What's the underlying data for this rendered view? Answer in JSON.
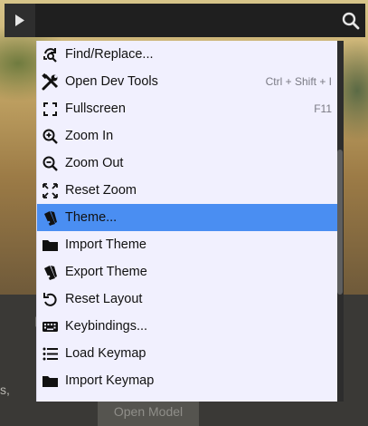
{
  "background": {
    "left_text": "s,",
    "open_model_button": "Open Model"
  },
  "toolbar": {
    "play_icon": "play-icon",
    "search_icon": "search-icon"
  },
  "menu": {
    "selected_color": "#4a8ef2",
    "items": [
      {
        "label": "Find/Replace...",
        "icon": "find-replace-icon",
        "shortcut": ""
      },
      {
        "label": "Open Dev Tools",
        "icon": "tools-icon",
        "shortcut": "Ctrl + Shift + I"
      },
      {
        "label": "Fullscreen",
        "icon": "fullscreen-icon",
        "shortcut": "F11"
      },
      {
        "label": "Zoom In",
        "icon": "zoom-in-icon",
        "shortcut": ""
      },
      {
        "label": "Zoom Out",
        "icon": "zoom-out-icon",
        "shortcut": ""
      },
      {
        "label": "Reset Zoom",
        "icon": "reset-zoom-icon",
        "shortcut": ""
      },
      {
        "label": "Theme...",
        "icon": "theme-icon",
        "shortcut": "",
        "selected": true
      },
      {
        "label": "Import Theme",
        "icon": "folder-icon",
        "shortcut": ""
      },
      {
        "label": "Export Theme",
        "icon": "export-theme-icon",
        "shortcut": ""
      },
      {
        "label": "Reset Layout",
        "icon": "undo-icon",
        "shortcut": ""
      },
      {
        "label": "Keybindings...",
        "icon": "keyboard-icon",
        "shortcut": ""
      },
      {
        "label": "Load Keymap",
        "icon": "list-icon",
        "shortcut": ""
      },
      {
        "label": "Import Keymap",
        "icon": "folder-icon",
        "shortcut": ""
      }
    ]
  }
}
